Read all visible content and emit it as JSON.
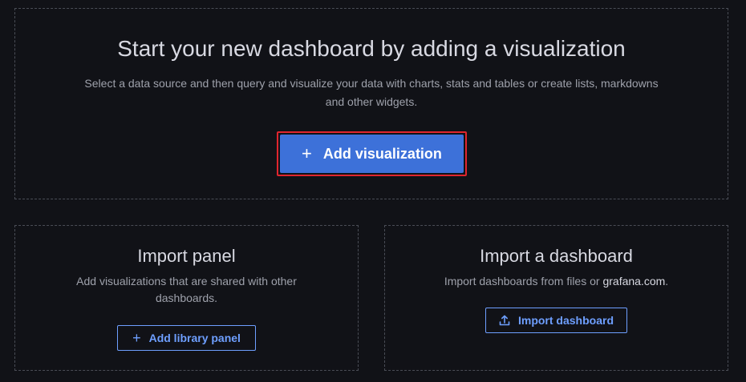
{
  "hero": {
    "title": "Start your new dashboard by adding a visualization",
    "description": "Select a data source and then query and visualize your data with charts, stats and tables or create lists, markdowns and other widgets.",
    "button_label": "Add visualization",
    "button_icon": "plus-icon"
  },
  "import_panel": {
    "title": "Import panel",
    "description": "Add visualizations that are shared with other dashboards.",
    "button_label": "Add library panel",
    "button_icon": "plus-icon"
  },
  "import_dashboard": {
    "title": "Import a dashboard",
    "description_prefix": "Import dashboards from files or ",
    "description_link": "grafana.com",
    "description_suffix": ".",
    "button_label": "Import dashboard",
    "button_icon": "upload-icon"
  },
  "colors": {
    "background": "#111217",
    "primary": "#3d71d9",
    "accent_text": "#6e9fff",
    "focus_ring": "#e0252e",
    "border": "#4a4d56"
  }
}
